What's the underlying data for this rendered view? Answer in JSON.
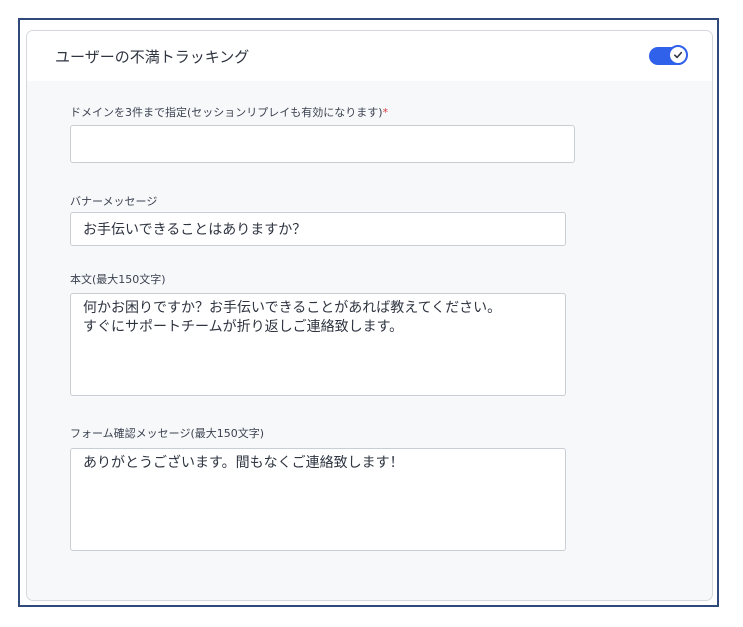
{
  "header": {
    "title": "ユーザーの不満トラッキング",
    "toggle_on": true
  },
  "fields": {
    "domains": {
      "label": "ドメインを3件まで指定(セッションリプレイも有効になります)",
      "required_mark": "*",
      "value": ""
    },
    "banner": {
      "label": "バナーメッセージ",
      "value": "お手伝いできることはありますか？"
    },
    "body": {
      "label": "本文(最大150文字)",
      "value": "何かお困りですか？お手伝いできることがあれば教えてください。\nすぐにサポートチームが折り返しご連絡致します。"
    },
    "confirmation": {
      "label": "フォーム確認メッセージ(最大150文字)",
      "value": "ありがとうございます。間もなくご連絡致します！"
    }
  },
  "colors": {
    "accent": "#2f61ea",
    "required": "#d43a3a",
    "frame_border": "#2f4a7a"
  }
}
